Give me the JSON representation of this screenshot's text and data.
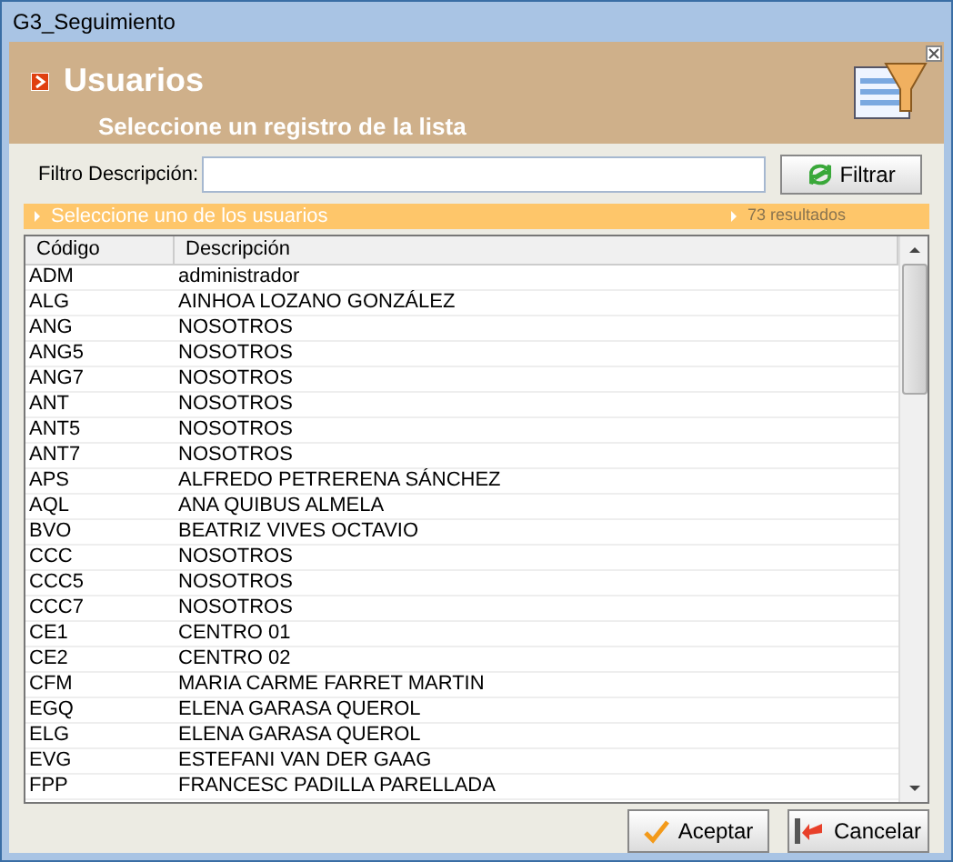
{
  "window": {
    "title": "G3_Seguimiento"
  },
  "header": {
    "title": "Usuarios",
    "subtitle": "Seleccione un registro de la lista"
  },
  "filter": {
    "label": "Filtro Descripción:",
    "button": "Filtrar"
  },
  "banner": {
    "text": "Seleccione uno de los usuarios",
    "count": "73 resultados"
  },
  "table": {
    "columns": [
      "Código",
      "Descripción"
    ],
    "rows": [
      [
        "ADM",
        "administrador"
      ],
      [
        "ALG",
        "AINHOA LOZANO GONZÁLEZ"
      ],
      [
        "ANG",
        "NOSOTROS"
      ],
      [
        "ANG5",
        "NOSOTROS"
      ],
      [
        "ANG7",
        "NOSOTROS"
      ],
      [
        "ANT",
        "NOSOTROS"
      ],
      [
        "ANT5",
        "NOSOTROS"
      ],
      [
        "ANT7",
        "NOSOTROS"
      ],
      [
        "APS",
        "ALFREDO PETRERENA SÁNCHEZ"
      ],
      [
        "AQL",
        "ANA QUIBUS ALMELA"
      ],
      [
        "BVO",
        "BEATRIZ VIVES OCTAVIO"
      ],
      [
        "CCC",
        "NOSOTROS"
      ],
      [
        "CCC5",
        "NOSOTROS"
      ],
      [
        "CCC7",
        "NOSOTROS"
      ],
      [
        "CE1",
        "CENTRO 01"
      ],
      [
        "CE2",
        "CENTRO 02"
      ],
      [
        "CFM",
        "MARIA CARME FARRET MARTIN"
      ],
      [
        "EGQ",
        "ELENA GARASA QUEROL"
      ],
      [
        "ELG",
        "ELENA GARASA QUEROL"
      ],
      [
        "EVG",
        "ESTEFANI VAN DER GAAG"
      ],
      [
        "FPP",
        "FRANCESC PADILLA PARELLADA"
      ]
    ]
  },
  "buttons": [
    {
      "kind": "accept",
      "label": "Aceptar"
    },
    {
      "kind": "cancel",
      "label": "Cancelar"
    }
  ]
}
